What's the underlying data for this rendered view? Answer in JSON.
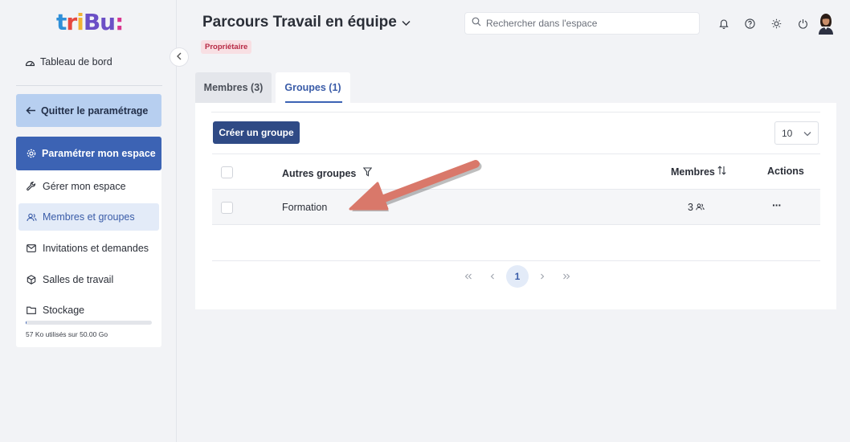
{
  "brand": {
    "logo_letters": [
      "t",
      "r",
      "i",
      "B",
      "u",
      ":"
    ]
  },
  "sidebar": {
    "dashboard": "Tableau de bord",
    "quit": "Quitter le paramétrage",
    "configure": "Paramétrer mon espace",
    "items": [
      {
        "label": "Gérer mon espace",
        "icon": "wrench-icon"
      },
      {
        "label": "Membres et groupes",
        "icon": "users-icon"
      },
      {
        "label": "Invitations et demandes",
        "icon": "mail-icon"
      },
      {
        "label": "Salles de travail",
        "icon": "cube-icon"
      },
      {
        "label": "Stockage",
        "icon": "folder-icon"
      }
    ],
    "storage_text": "57 Ko utilisés sur 50.00 Go",
    "storage_fraction": 0.001
  },
  "header": {
    "title": "Parcours Travail en équipe",
    "badge": "Propriétaire",
    "search_placeholder": "Rechercher dans l'espace",
    "icons": [
      "bell-icon",
      "help-icon",
      "sun-icon",
      "power-icon"
    ]
  },
  "tabs": [
    {
      "label": "Membres (3)",
      "active": false
    },
    {
      "label": "Groupes (1)",
      "active": true
    }
  ],
  "toolbar": {
    "create_label": "Créer un groupe",
    "per_page": "10"
  },
  "table": {
    "columns": {
      "name": "Autres groupes",
      "members": "Membres",
      "actions": "Actions"
    },
    "rows": [
      {
        "name": "Formation",
        "members": "3",
        "actions": "···"
      }
    ]
  },
  "pagination": {
    "current": "1"
  },
  "colors": {
    "primary": "#3c63b4",
    "primary_dark": "#2f4a85",
    "badge": "#b72a45",
    "annotation_arrow": "#d9786a"
  }
}
